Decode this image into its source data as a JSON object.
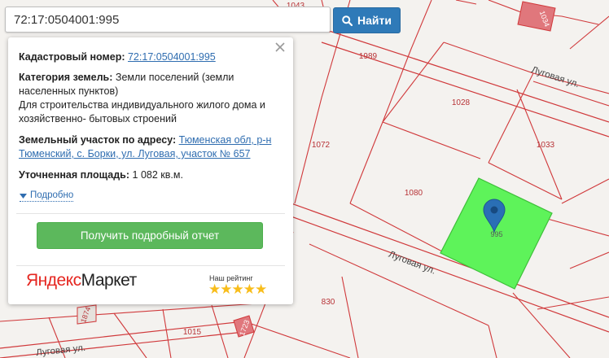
{
  "search": {
    "value": "72:17:0504001:995",
    "button_label": "Найти"
  },
  "panel": {
    "cadastral_label": "Кадастровый номер:",
    "cadastral_value": "72:17:0504001:995",
    "category_label": "Категория земель:",
    "category_value": "Земли поселений (земли населенных пунктов)",
    "usage": "Для строительства индивидуального жилого дома и хозяйственно- бытовых строений",
    "address_label": "Земельный участок по адресу:",
    "address_value": "Тюменская обл, р-н Тюменский, с. Борки, ул. Луговая, участок № 657",
    "area_label": "Уточненная площадь:",
    "area_value": "1 082 кв.м.",
    "more_label": "Подробно",
    "report_button": "Получить подробный отчет",
    "brand_red": "Яндекс",
    "brand_black": "Маркет",
    "rating_label": "Наш рейтинг",
    "stars": "★★★★★"
  },
  "map": {
    "parcel_labels": {
      "p1043": "1043",
      "p1034": "1034",
      "p1989": "1989",
      "p1028": "1028",
      "p1072": "1072",
      "p1033": "1033",
      "p1080": "1080",
      "p995": "995",
      "p830": "830",
      "p1015": "1015",
      "p1874": "1874",
      "p1723": "1723"
    },
    "streets": {
      "s1": "Луговая ул.",
      "s2": "Луговая ул.",
      "s3": "Луговая ул."
    },
    "highlight_color": "#5ef35a",
    "boundary_color": "#d0393b",
    "marker_color": "#2a6fb5"
  },
  "colors": {
    "accent": "#2f7ab8",
    "green": "#5cb85c",
    "link": "#2f6db0"
  }
}
